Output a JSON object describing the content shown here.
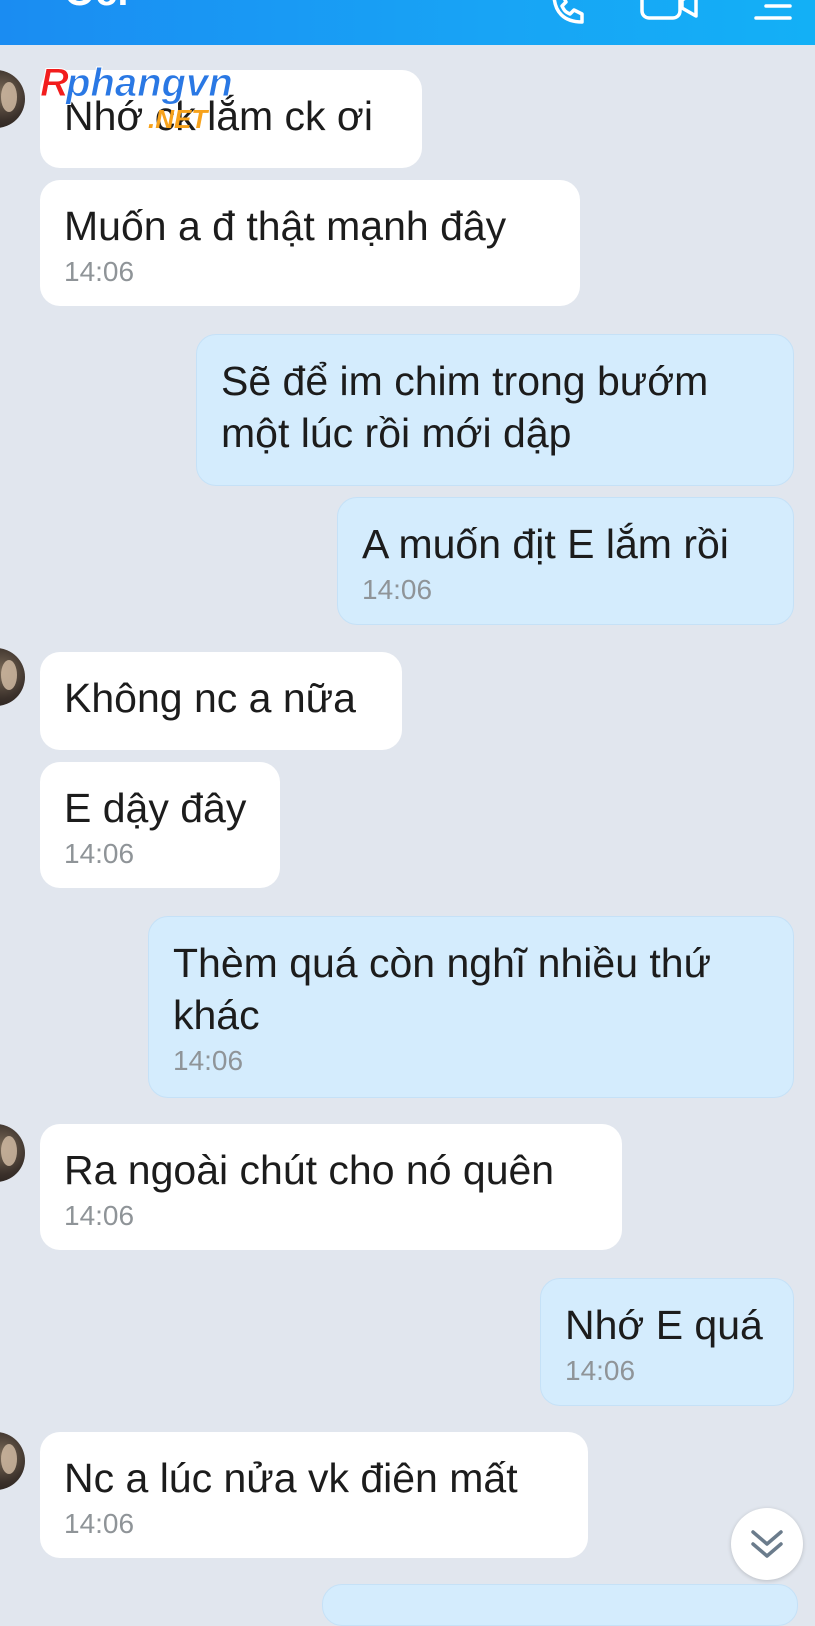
{
  "header": {
    "title": "Oci",
    "accent_color": "#1a8cf2",
    "icons": [
      "phone-icon",
      "video-call-icon",
      "menu-list-icon"
    ]
  },
  "watermark": {
    "brand": "Rphangvn",
    "suffix": ".NET"
  },
  "messages": [
    {
      "side": "incoming",
      "text": "Nhớ ck lắm ck ơi"
    },
    {
      "side": "incoming",
      "text": "Muốn a đ thật mạnh đây",
      "time": "14:06"
    },
    {
      "side": "outgoing",
      "text": [
        "Sẽ để im chim trong bướm",
        "một lúc rồi mới dập"
      ]
    },
    {
      "side": "outgoing",
      "text": "A muốn địt E lắm rồi",
      "time": "14:06"
    },
    {
      "side": "incoming",
      "text": "Không nc a nữa"
    },
    {
      "side": "incoming",
      "text": "E dậy đây",
      "time": "14:06"
    },
    {
      "side": "outgoing",
      "text": [
        "Thèm quá còn nghĩ nhiều thứ",
        "khác"
      ],
      "time": "14:06"
    },
    {
      "side": "incoming",
      "text": "Ra ngoài chút cho nó quên",
      "time": "14:06"
    },
    {
      "side": "outgoing",
      "text": "Nhớ E quá",
      "time": "14:06"
    },
    {
      "side": "incoming",
      "text": "Nc a lúc nửa vk điên mất",
      "time": "14:06"
    }
  ]
}
